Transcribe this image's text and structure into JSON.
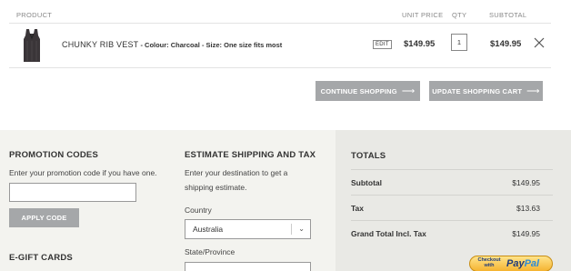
{
  "cart": {
    "headers": {
      "product": "PRODUCT",
      "unit_price": "UNIT PRICE",
      "qty": "QTY",
      "subtotal": "SUBTOTAL"
    },
    "item": {
      "name": "CHUNKY RIB VEST",
      "options": " - Colour: Charcoal - Size: One size fits most",
      "edit_label": "EDIT",
      "unit_price": "$149.95",
      "qty": "1",
      "subtotal": "$149.95"
    },
    "continue_label": "CONTINUE SHOPPING",
    "update_label": "UPDATE SHOPPING CART"
  },
  "promo": {
    "title": "PROMOTION CODES",
    "instructions": "Enter your promotion code if you have one.",
    "code_value": "",
    "apply_label": "APPLY CODE"
  },
  "egift": {
    "title": "E-GIFT CARDS"
  },
  "shipping": {
    "title": "ESTIMATE SHIPPING AND TAX",
    "instructions": "Enter your destination to get a shipping estimate.",
    "country_label": "Country",
    "country_value": "Australia",
    "state_label": "State/Province"
  },
  "totals": {
    "title": "TOTALS",
    "rows": [
      {
        "label": "Subtotal",
        "value": "$149.95"
      },
      {
        "label": "Tax",
        "value": "$13.63"
      },
      {
        "label": "Grand Total Incl. Tax",
        "value": "$149.95"
      }
    ]
  },
  "paypal": {
    "small_text": "Checkout with",
    "logo_a": "Pay",
    "logo_b": "Pal"
  },
  "colors": {
    "button_grey": "#a5a7a9",
    "band_bg": "#f3f3ef",
    "totals_bg": "#e9e9e5"
  }
}
